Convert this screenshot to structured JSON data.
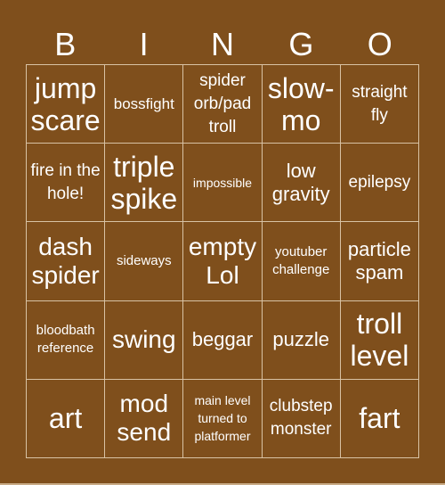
{
  "card": {
    "background_color": "#7f4f1c",
    "line_color": "#d8c2a4",
    "text_color": "#ffffff",
    "header": [
      "B",
      "I",
      "N",
      "G",
      "O"
    ],
    "rows": [
      [
        "jump scare",
        "bossfight",
        "spider orb/pad troll",
        "slow-mo",
        "straight fly"
      ],
      [
        "fire in the hole!",
        "triple spike",
        "impossible",
        "low gravity",
        "epilepsy"
      ],
      [
        "dash spider",
        "sideways",
        "empty Lol",
        "youtuber challenge",
        "particle spam"
      ],
      [
        "bloodbath reference",
        "swing",
        "beggar",
        "puzzle",
        "troll level"
      ],
      [
        "art",
        "mod send",
        "main level turned to platformer",
        "clubstep monster",
        "fart"
      ]
    ]
  }
}
